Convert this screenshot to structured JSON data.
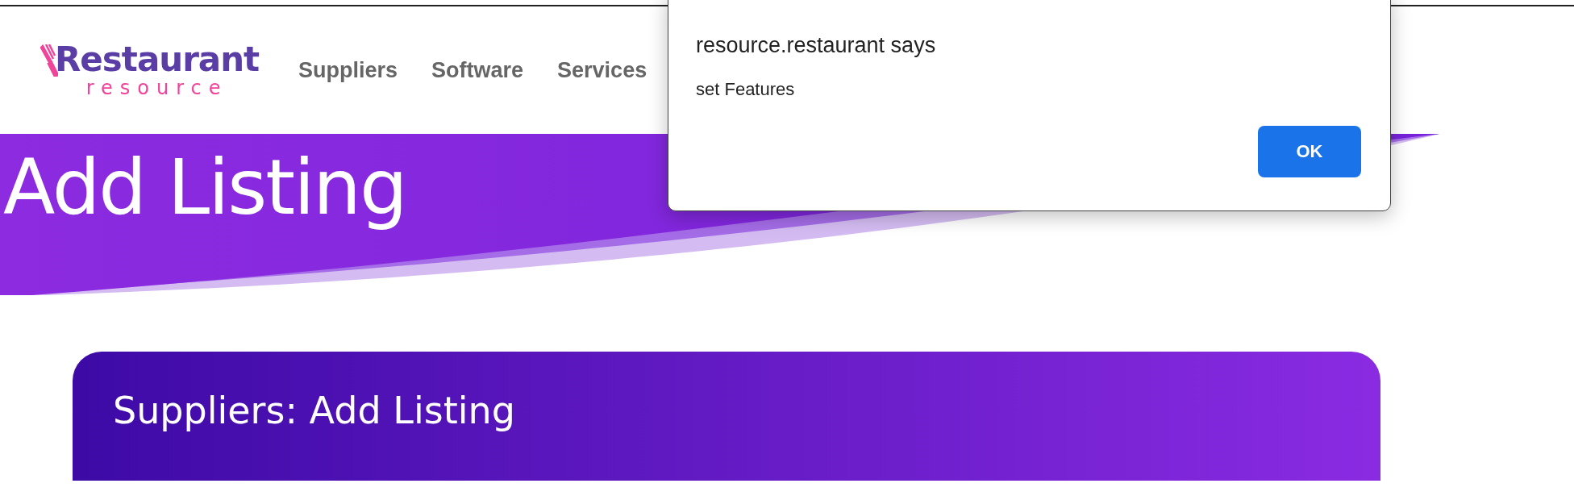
{
  "header": {
    "logo": {
      "name": "Restaurant",
      "tagline": "resource"
    },
    "nav": [
      {
        "label": "Suppliers"
      },
      {
        "label": "Software"
      },
      {
        "label": "Services"
      }
    ]
  },
  "hero": {
    "title": "Add Listing"
  },
  "card": {
    "title": "Suppliers: Add Listing"
  },
  "dialog": {
    "title": "resource.restaurant says",
    "message": "set Features",
    "buttons": [
      "OK"
    ]
  }
}
